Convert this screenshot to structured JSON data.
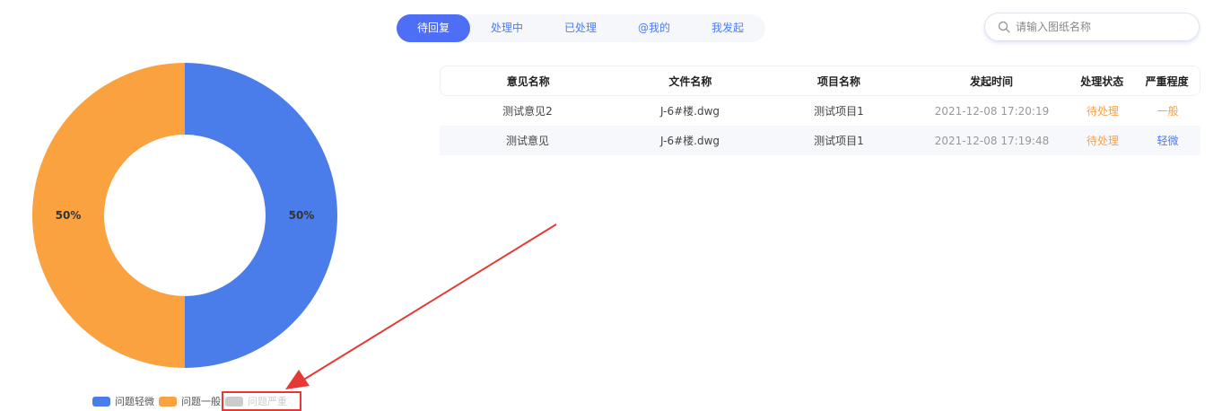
{
  "tabs": [
    {
      "label": "待回复",
      "active": true
    },
    {
      "label": "处理中",
      "active": false
    },
    {
      "label": "已处理",
      "active": false
    },
    {
      "label": "@我的",
      "active": false
    },
    {
      "label": "我发起",
      "active": false
    }
  ],
  "search": {
    "placeholder": "请输入图纸名称",
    "icon": "search-icon"
  },
  "table": {
    "headers": [
      "意见名称",
      "文件名称",
      "项目名称",
      "发起时间",
      "处理状态",
      "严重程度"
    ],
    "rows": [
      [
        "测试意见2",
        "J-6#楼.dwg",
        "测试项目1",
        "2021-12-08 17:20:19",
        "待处理",
        "一般"
      ],
      [
        "测试意见",
        "J-6#楼.dwg",
        "测试项目1",
        "2021-12-08 17:19:48",
        "待处理",
        "轻微"
      ]
    ]
  },
  "chart_data": {
    "type": "pie",
    "donut": true,
    "slices": [
      {
        "name": "问题轻微",
        "value": 50,
        "label": "50%",
        "color": "#4a7de9"
      },
      {
        "name": "问题一般",
        "value": 50,
        "label": "50%",
        "color": "#fba240"
      }
    ],
    "legend": [
      {
        "name": "问题轻微",
        "color": "#4a7de9",
        "enabled": true
      },
      {
        "name": "问题一般",
        "color": "#fba240",
        "enabled": true
      },
      {
        "name": "问题严重",
        "color": "#cccccc",
        "enabled": false
      }
    ],
    "legend_position": "bottom"
  },
  "annotation": {
    "type": "red-arrow",
    "color": "#e53935"
  }
}
